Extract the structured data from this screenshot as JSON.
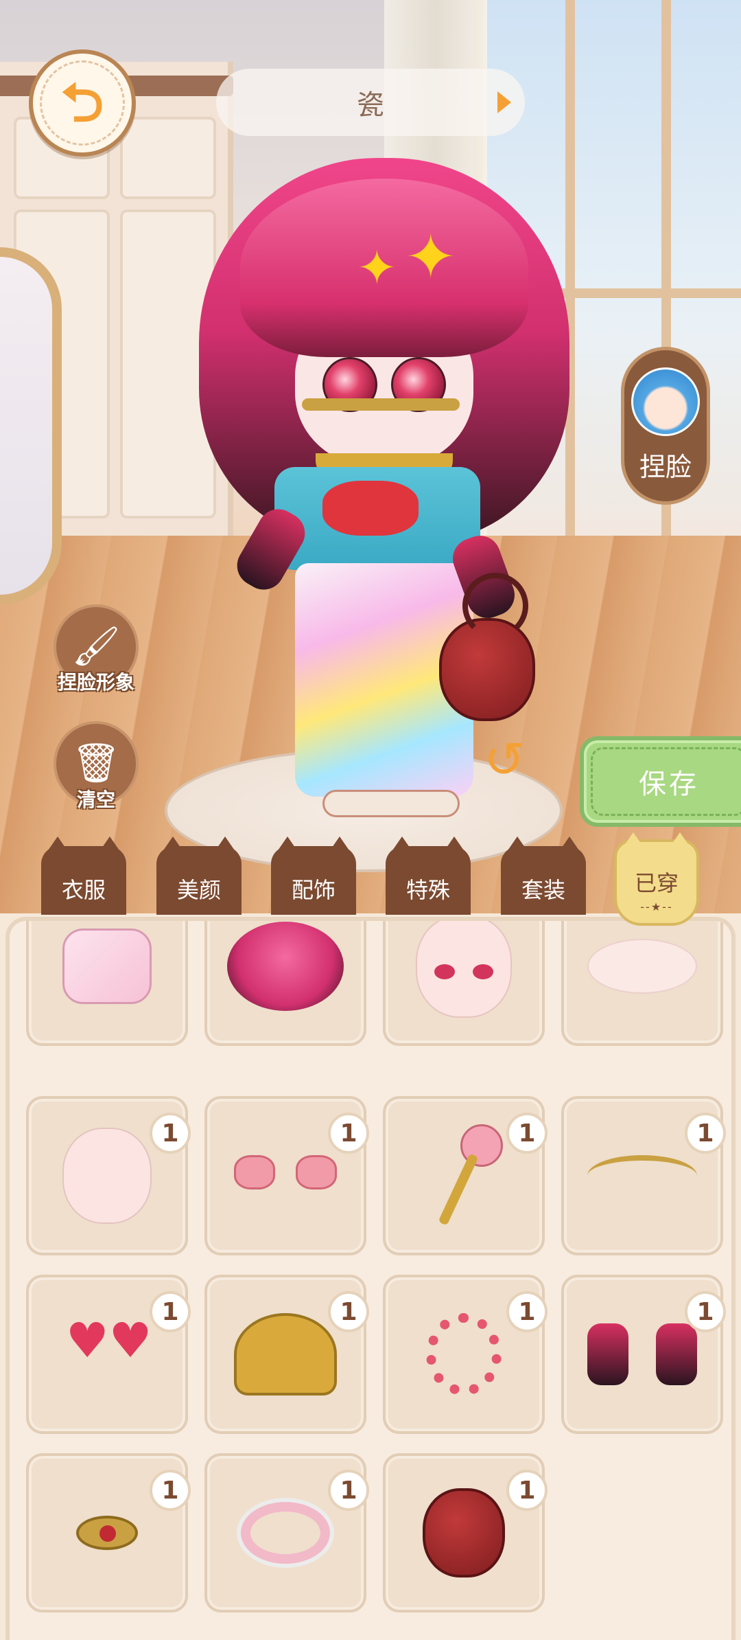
{
  "header": {
    "back_icon": "back-arrow-icon",
    "name_text": "瓷"
  },
  "side_buttons": {
    "face_edit_label": "捏脸",
    "face_edit_icon": "character-avatar-icon",
    "image_edit_label": "捏脸形象",
    "image_edit_icon": "brush-icon",
    "clear_label": "清空",
    "clear_icon": "trash-icon",
    "rotate_icon": "rotate-arrow-icon"
  },
  "save_label": "保存",
  "tabs": [
    {
      "label": "衣服"
    },
    {
      "label": "美颜"
    },
    {
      "label": "配饰"
    },
    {
      "label": "特殊"
    },
    {
      "label": "套装"
    },
    {
      "label": "已穿",
      "active": true
    }
  ],
  "items": [
    {
      "name": "socks",
      "icon": "socks-icon",
      "count": ""
    },
    {
      "name": "pink-hair",
      "icon": "hair-icon",
      "count": ""
    },
    {
      "name": "face-red-eyes",
      "icon": "face-icon",
      "count": ""
    },
    {
      "name": "skin-base",
      "icon": "skin-icon",
      "count": ""
    },
    {
      "name": "plain-face",
      "icon": "face-icon",
      "count": "1"
    },
    {
      "name": "pink-bows",
      "icon": "bow-icon",
      "count": "1"
    },
    {
      "name": "rose-hairpin",
      "icon": "rose-icon",
      "count": "1"
    },
    {
      "name": "gold-chain",
      "icon": "chain-icon",
      "count": "1"
    },
    {
      "name": "heart-earrings",
      "icon": "heart-icon",
      "count": "1"
    },
    {
      "name": "gold-necklace",
      "icon": "necklace-icon",
      "count": "1"
    },
    {
      "name": "bead-bracelet",
      "icon": "beads-icon",
      "count": "1"
    },
    {
      "name": "gradient-gloves",
      "icon": "glove-icon",
      "count": "1"
    },
    {
      "name": "gold-brooch",
      "icon": "brooch-icon",
      "count": "1"
    },
    {
      "name": "ribbon-bracelet",
      "icon": "bracelet-icon",
      "count": "1"
    },
    {
      "name": "apple-bag",
      "icon": "apple-bag-icon",
      "count": "1"
    }
  ],
  "colors": {
    "accent_orange": "#f4a034",
    "tab_brown": "#7b4a31",
    "tab_active": "#f3dc8b",
    "save_green": "#a8d881",
    "panel_bg": "#f8ece0"
  }
}
